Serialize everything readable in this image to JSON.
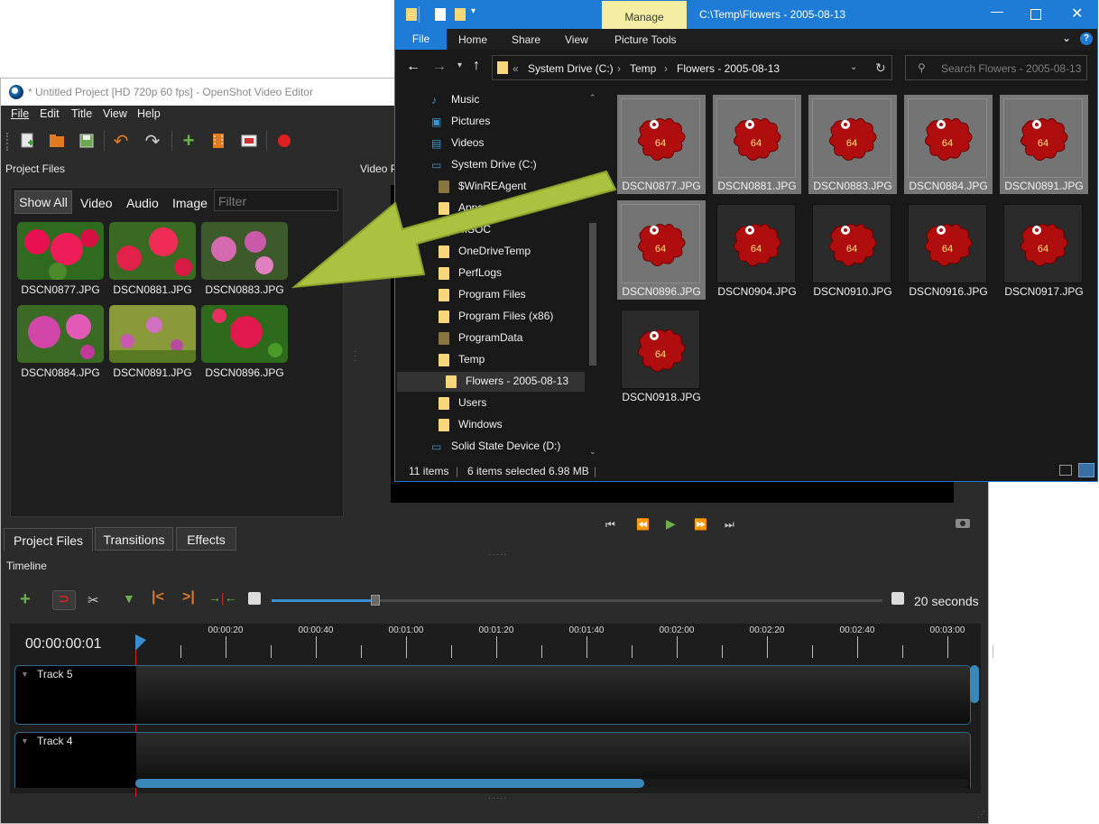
{
  "openshot": {
    "title": "* Untitled Project [HD 720p 60 fps] - OpenShot Video Editor",
    "menu": [
      "File",
      "Edit",
      "Title",
      "View",
      "Help"
    ],
    "project_files_label": "Project Files",
    "video_preview_label": "Video P",
    "filters": {
      "show_all": "Show All",
      "video": "Video",
      "audio": "Audio",
      "image": "Image",
      "filter_placeholder": "Filter"
    },
    "files": [
      "DSCN0877.JPG",
      "DSCN0881.JPG",
      "DSCN0883.JPG",
      "DSCN0884.JPG",
      "DSCN0891.JPG",
      "DSCN0896.JPG"
    ],
    "bottom_tabs": [
      "Project Files",
      "Transitions",
      "Effects"
    ],
    "timeline_label": "Timeline",
    "zoom_label": "20 seconds",
    "timecode": "00:00:00:01",
    "ruler": [
      "00:00:20",
      "00:00:40",
      "00:01:00",
      "00:01:20",
      "00:01:40",
      "00:02:00",
      "00:02:20",
      "00:02:40",
      "00:03:00"
    ],
    "tracks": [
      "Track 5",
      "Track 4"
    ],
    "zoom_slider_fraction": 0.17,
    "scroll_fraction": 0.61
  },
  "explorer": {
    "manage_tab": "Manage",
    "title_path": "C:\\Temp\\Flowers - 2005-08-13",
    "ribbon": {
      "file": "File",
      "home": "Home",
      "share": "Share",
      "view": "View",
      "picture_tools": "Picture Tools"
    },
    "breadcrumb": {
      "chevrons": "«",
      "drive": "System Drive (C:)",
      "temp": "Temp",
      "folder": "Flowers - 2005-08-13"
    },
    "search_placeholder": "Search Flowers - 2005-08-13",
    "tree": [
      {
        "label": "Music",
        "icon": "music-icon"
      },
      {
        "label": "Pictures",
        "icon": "pictures-icon"
      },
      {
        "label": "Videos",
        "icon": "videos-icon"
      },
      {
        "label": "System Drive (C:)",
        "icon": "drive-icon"
      },
      {
        "label": "$WinREAgent",
        "icon": "folder-icon"
      },
      {
        "label": "Apps",
        "icon": "folder-icon"
      },
      {
        "label": "MSOC",
        "icon": "folder-icon"
      },
      {
        "label": "OneDriveTemp",
        "icon": "folder-icon"
      },
      {
        "label": "PerfLogs",
        "icon": "folder-icon"
      },
      {
        "label": "Program Files",
        "icon": "folder-icon"
      },
      {
        "label": "Program Files (x86)",
        "icon": "folder-icon"
      },
      {
        "label": "ProgramData",
        "icon": "folder-icon"
      },
      {
        "label": "Temp",
        "icon": "folder-icon"
      },
      {
        "label": "Flowers - 2005-08-13",
        "icon": "folder-icon"
      },
      {
        "label": "Users",
        "icon": "folder-icon"
      },
      {
        "label": "Windows",
        "icon": "folder-icon"
      },
      {
        "label": "Solid State Device (D:)",
        "icon": "drive-icon"
      }
    ],
    "files": [
      {
        "name": "DSCN0877.JPG",
        "selected": true
      },
      {
        "name": "DSCN0881.JPG",
        "selected": true
      },
      {
        "name": "DSCN0883.JPG",
        "selected": true
      },
      {
        "name": "DSCN0884.JPG",
        "selected": true
      },
      {
        "name": "DSCN0891.JPG",
        "selected": true
      },
      {
        "name": "DSCN0896.JPG",
        "selected": true
      },
      {
        "name": "DSCN0904.JPG",
        "selected": false
      },
      {
        "name": "DSCN0910.JPG",
        "selected": false
      },
      {
        "name": "DSCN0916.JPG",
        "selected": false
      },
      {
        "name": "DSCN0917.JPG",
        "selected": false
      },
      {
        "name": "DSCN0918.JPG",
        "selected": false
      }
    ],
    "thumb_badge": "64",
    "status": {
      "items": "11 items",
      "selected": "6 items selected  6.98 MB"
    }
  },
  "colors": {
    "accent_blue": "#1e7bd6",
    "manage_yellow": "#f3eea2",
    "arrow_green": "#a9c23f",
    "playhead_red": "#d0202a",
    "track_border": "#2f6a8a"
  }
}
